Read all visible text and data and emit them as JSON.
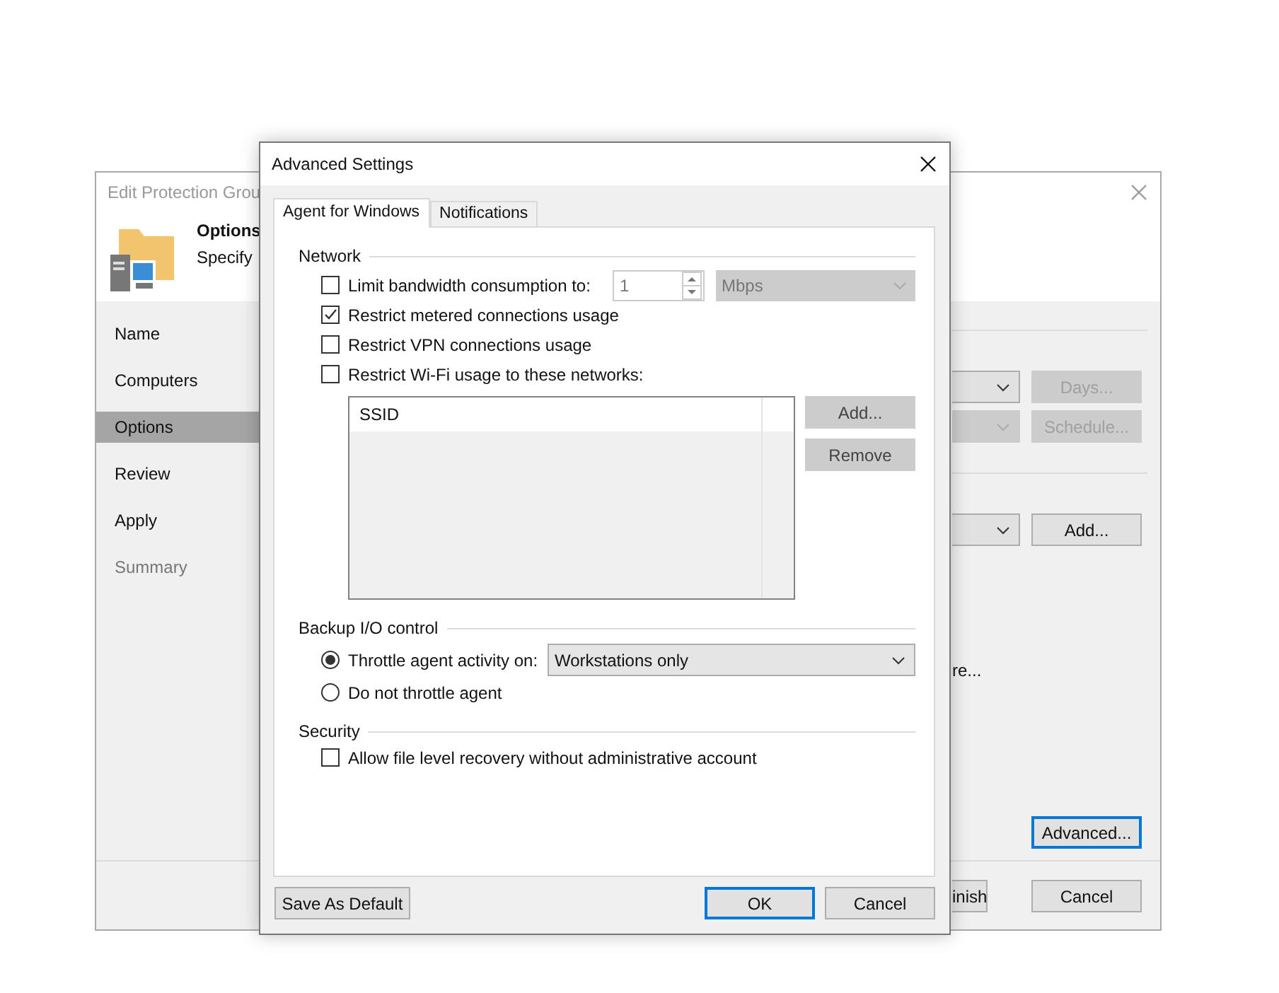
{
  "background_window": {
    "title": "Edit Protection Grou",
    "header": {
      "title": "Options",
      "subtitle": "Specify"
    },
    "steps": [
      {
        "label": "Name",
        "selected": false,
        "disabled": false
      },
      {
        "label": "Computers",
        "selected": false,
        "disabled": false
      },
      {
        "label": "Options",
        "selected": true,
        "disabled": false
      },
      {
        "label": "Review",
        "selected": false,
        "disabled": false
      },
      {
        "label": "Apply",
        "selected": false,
        "disabled": false
      },
      {
        "label": "Summary",
        "selected": false,
        "disabled": true
      }
    ],
    "schedule_rows": [
      {
        "dropdown_disabled": false,
        "button": "Days...",
        "button_disabled": true
      },
      {
        "dropdown_disabled": true,
        "button": "Schedule...",
        "button_disabled": true
      }
    ],
    "add_row": {
      "button": "Add..."
    },
    "link_fragment": "re...",
    "advanced_button": "Advanced...",
    "finish_button": "inish",
    "cancel_button": "Cancel"
  },
  "dialog": {
    "title": "Advanced Settings",
    "tabs": [
      {
        "label": "Agent for Windows",
        "selected": true
      },
      {
        "label": "Notifications",
        "selected": false
      }
    ],
    "network": {
      "heading": "Network",
      "options": [
        {
          "label": "Limit bandwidth consumption to:",
          "checked": false
        },
        {
          "label": "Restrict metered connections usage",
          "checked": true
        },
        {
          "label": "Restrict VPN connections usage",
          "checked": false
        },
        {
          "label": "Restrict Wi-Fi usage to these networks:",
          "checked": false
        }
      ],
      "bandwidth_value": "1",
      "bandwidth_unit": "Mbps",
      "ssid_column": "SSID",
      "list_buttons": [
        "Add...",
        "Remove"
      ]
    },
    "io_control": {
      "heading": "Backup I/O control",
      "options": [
        {
          "label": "Throttle agent activity on:",
          "selected": true
        },
        {
          "label": "Do not throttle agent",
          "selected": false
        }
      ],
      "throttle_target": "Workstations only"
    },
    "security": {
      "heading": "Security",
      "options": [
        {
          "label": "Allow file level recovery without administrative account",
          "checked": false
        }
      ]
    },
    "buttons": {
      "save_default": "Save As Default",
      "ok": "OK",
      "cancel": "Cancel"
    }
  }
}
